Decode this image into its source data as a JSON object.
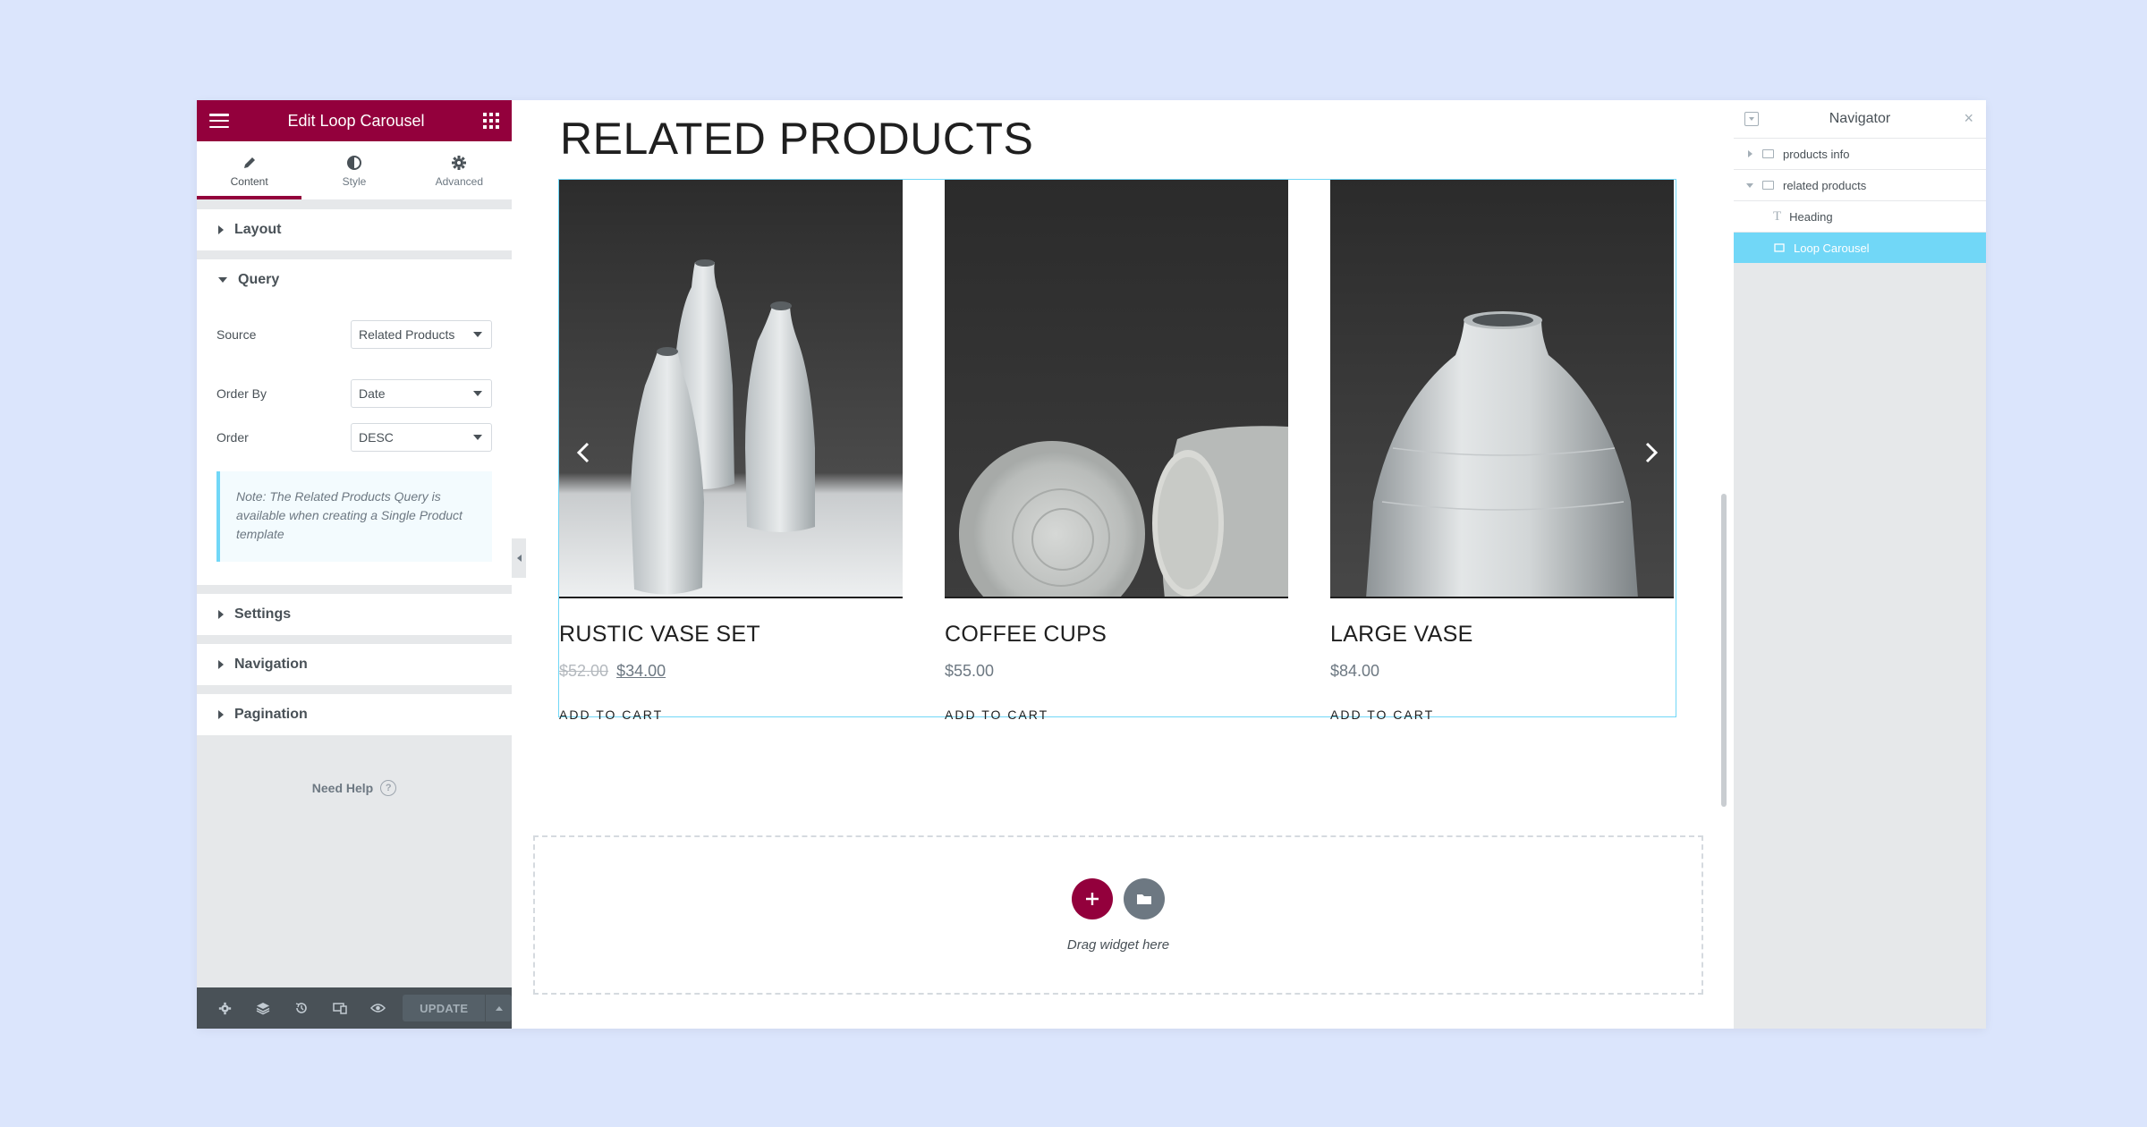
{
  "panel": {
    "title": "Edit Loop Carousel",
    "tabs": [
      {
        "label": "Content",
        "icon": "pencil-icon"
      },
      {
        "label": "Style",
        "icon": "half-circle-icon"
      },
      {
        "label": "Advanced",
        "icon": "gear-icon"
      }
    ],
    "sections": {
      "layout": "Layout",
      "query": "Query",
      "settings": "Settings",
      "navigation": "Navigation",
      "pagination": "Pagination"
    },
    "query": {
      "source_label": "Source",
      "source_value": "Related Products",
      "orderby_label": "Order By",
      "orderby_value": "Date",
      "order_label": "Order",
      "order_value": "DESC",
      "note": "Note: The Related Products Query is available when creating a Single Product template"
    },
    "help": "Need Help",
    "help_icon": "?",
    "footer": {
      "update_label": "UPDATE"
    }
  },
  "canvas": {
    "heading": "RELATED PRODUCTS",
    "products": [
      {
        "name": "RUSTIC VASE SET",
        "old_price": "$52.00",
        "price": "$34.00",
        "cart": "ADD TO CART"
      },
      {
        "name": "COFFEE CUPS",
        "price": "$55.00",
        "cart": "ADD TO CART"
      },
      {
        "name": "LARGE VASE",
        "price": "$84.00",
        "cart": "ADD TO CART"
      }
    ],
    "dropzone_text": "Drag widget here"
  },
  "navigator": {
    "title": "Navigator",
    "close": "×",
    "items": [
      {
        "label": "products info"
      },
      {
        "label": "related products"
      },
      {
        "label": "Heading"
      },
      {
        "label": "Loop Carousel"
      }
    ]
  },
  "colors": {
    "brand": "#93003c",
    "accent": "#71d7f7",
    "page_bg": "#dbe5fc"
  }
}
